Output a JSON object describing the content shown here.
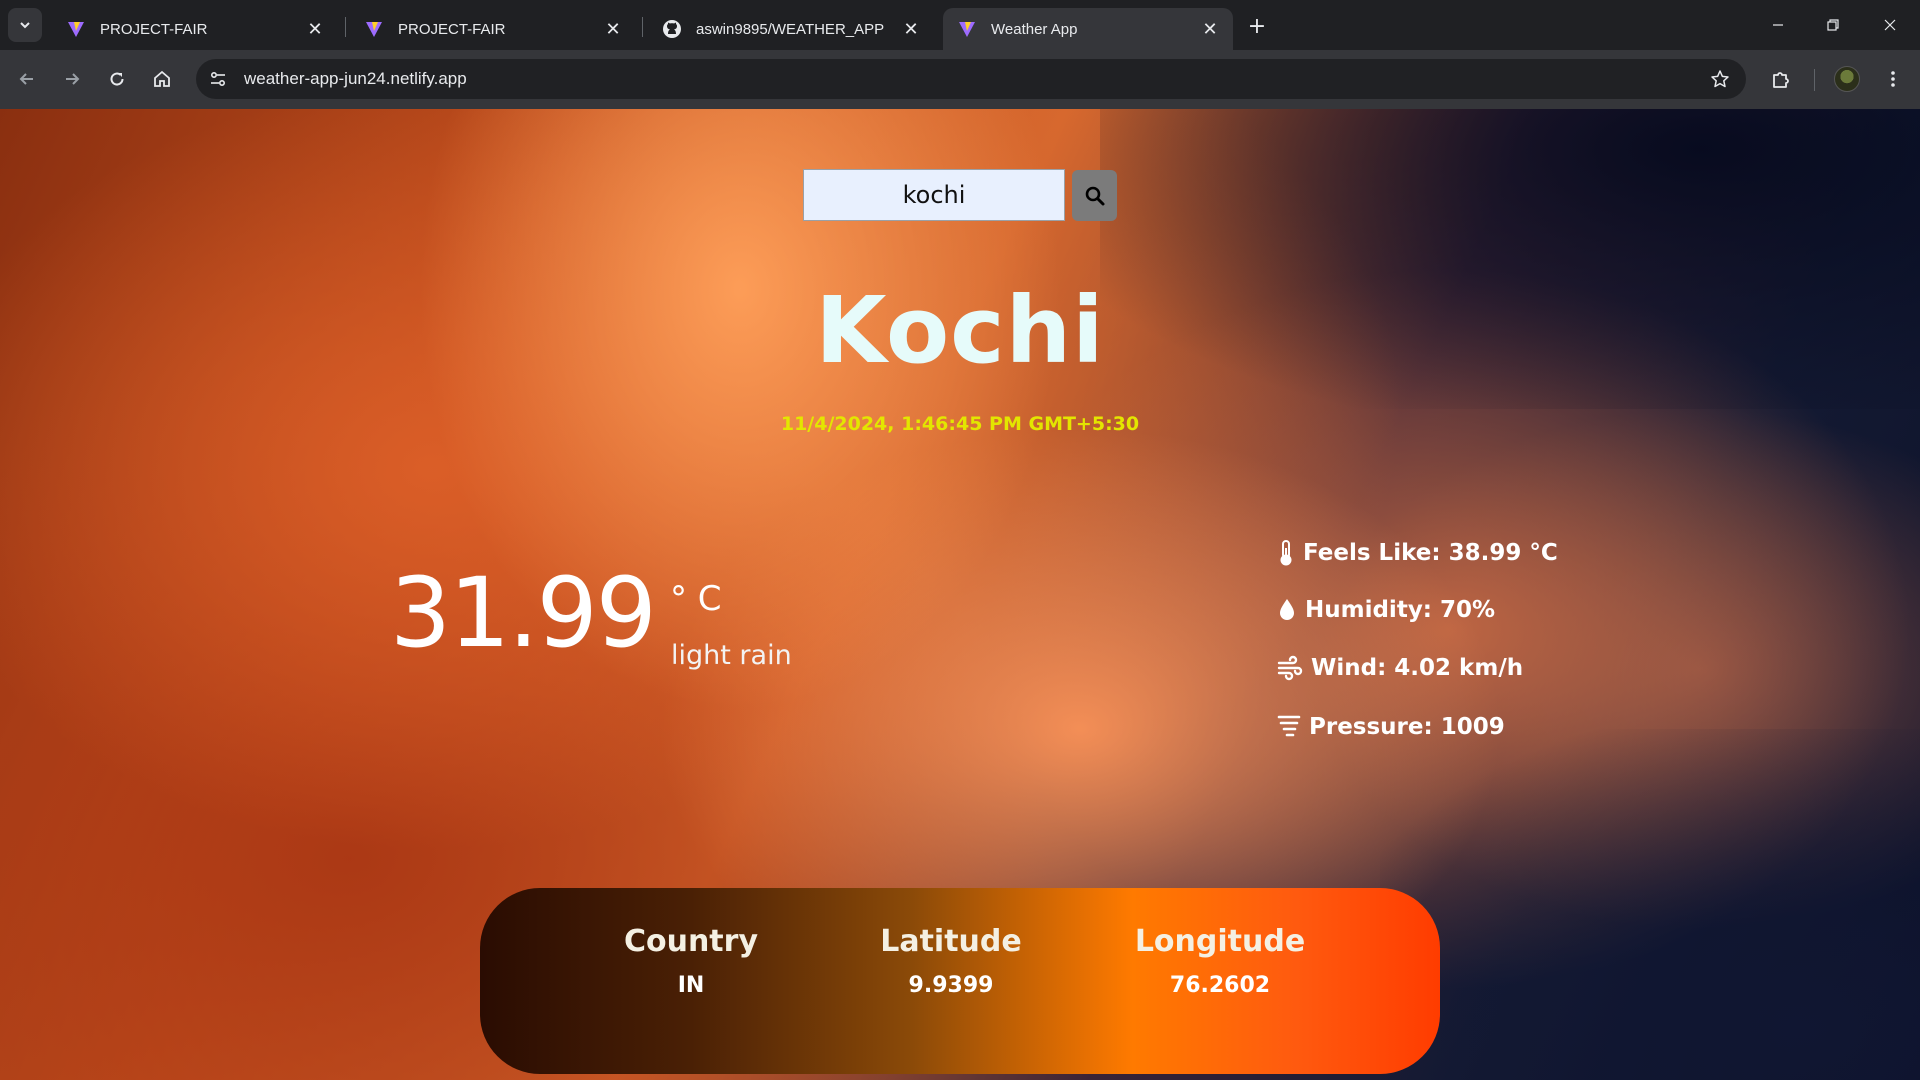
{
  "browser": {
    "tabs": [
      {
        "title": "PROJECT-FAIR",
        "icon": "vite-logo-icon",
        "active": false
      },
      {
        "title": "PROJECT-FAIR",
        "icon": "vite-logo-icon",
        "active": false
      },
      {
        "title": "aswin9895/WEATHER_APP",
        "icon": "github-icon",
        "active": false
      },
      {
        "title": "Weather App",
        "icon": "vite-logo-icon",
        "active": true
      }
    ],
    "url": "weather-app-jun24.netlify.app"
  },
  "search": {
    "value": "kochi"
  },
  "weather": {
    "city": "Kochi",
    "datetime": "11/4/2024, 1:46:45 PM GMT+5:30",
    "temperature": "31.99",
    "unit": "° C",
    "description": "light rain",
    "feels_like": "Feels Like: 38.99 °C",
    "humidity": "Humidity: 70%",
    "wind": "Wind: 4.02 km/h",
    "pressure": "Pressure: 1009"
  },
  "location": {
    "country_label": "Country",
    "country_value": "IN",
    "latitude_label": "Latitude",
    "latitude_value": "9.9399",
    "longitude_label": "Longitude",
    "longitude_value": "76.2602"
  },
  "colors": {
    "accent_date": "#e3e600",
    "city_text": "#e6fbfa"
  }
}
